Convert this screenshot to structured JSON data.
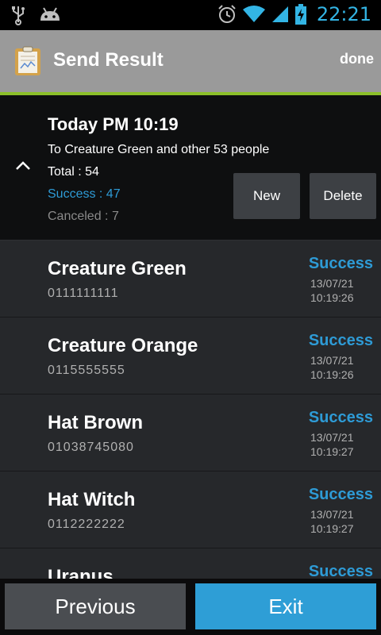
{
  "status_bar": {
    "time": "22:21",
    "icons": [
      "usb-icon",
      "android-icon",
      "alarm-icon",
      "wifi-icon",
      "signal-icon",
      "battery-charging-icon"
    ]
  },
  "action_bar": {
    "title": "Send Result",
    "done_label": "done",
    "accent_color": "#8cc02a"
  },
  "summary": {
    "title": "Today PM 10:19",
    "recipients": "To Creature Green and other 53 people",
    "total": "Total : 54",
    "success": "Success : 47",
    "canceled": "Canceled : 7",
    "new_label": "New",
    "delete_label": "Delete"
  },
  "results": [
    {
      "name": "Creature Green",
      "number": "0111111111",
      "status": "Success",
      "date": "13/07/21",
      "time": "10:19:26"
    },
    {
      "name": "Creature Orange",
      "number": "0115555555",
      "status": "Success",
      "date": "13/07/21",
      "time": "10:19:26"
    },
    {
      "name": "Hat Brown",
      "number": "01038745080",
      "status": "Success",
      "date": "13/07/21",
      "time": "10:19:27"
    },
    {
      "name": "Hat Witch",
      "number": "0112222222",
      "status": "Success",
      "date": "13/07/21",
      "time": "10:19:27"
    },
    {
      "name": "Uranus",
      "number": "",
      "status": "Success",
      "date": "",
      "time": ""
    }
  ],
  "footer": {
    "previous_label": "Previous",
    "exit_label": "Exit"
  },
  "colors": {
    "accent_blue": "#2e9bd6",
    "status_blue": "#33b5e5"
  }
}
